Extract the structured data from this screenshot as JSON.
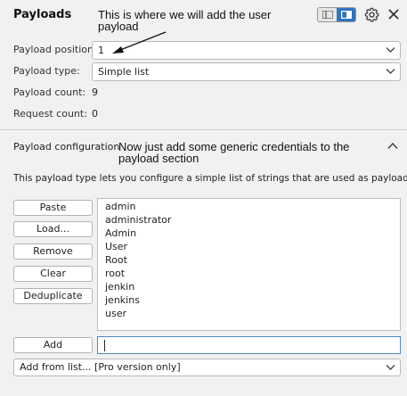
{
  "header": {
    "title": "Payloads",
    "view_icons": [
      "list-view-icon",
      "panel-view-icon"
    ],
    "settings_icon": "gear-icon",
    "close_icon": "close-icon"
  },
  "form": {
    "payload_position_label": "Payload position:",
    "payload_position_value": "1",
    "payload_type_label": "Payload type:",
    "payload_type_value": "Simple list",
    "payload_count_label": "Payload count:",
    "payload_count_value": "9",
    "request_count_label": "Request count:",
    "request_count_value": "0"
  },
  "config": {
    "section_title": "Payload configuration",
    "description": "This payload type lets you configure a simple list of strings that are used as payloads.",
    "buttons": {
      "paste": "Paste",
      "load": "Load...",
      "remove": "Remove",
      "clear": "Clear",
      "deduplicate": "Deduplicate",
      "add": "Add"
    },
    "items": [
      "admin",
      "administrator",
      "Admin",
      "User",
      "Root",
      "root",
      "jenkin",
      "jenkins",
      "user"
    ],
    "add_input_value": "",
    "add_from_list": "Add from list... [Pro version only]"
  },
  "annotations": {
    "note1": "This is where we will add the user payload",
    "note2": "Now just add some generic credentials to the payload section"
  },
  "colors": {
    "accent": "#2f74c0",
    "background": "#f1f1f1",
    "input_focus": "#4f86c6"
  }
}
